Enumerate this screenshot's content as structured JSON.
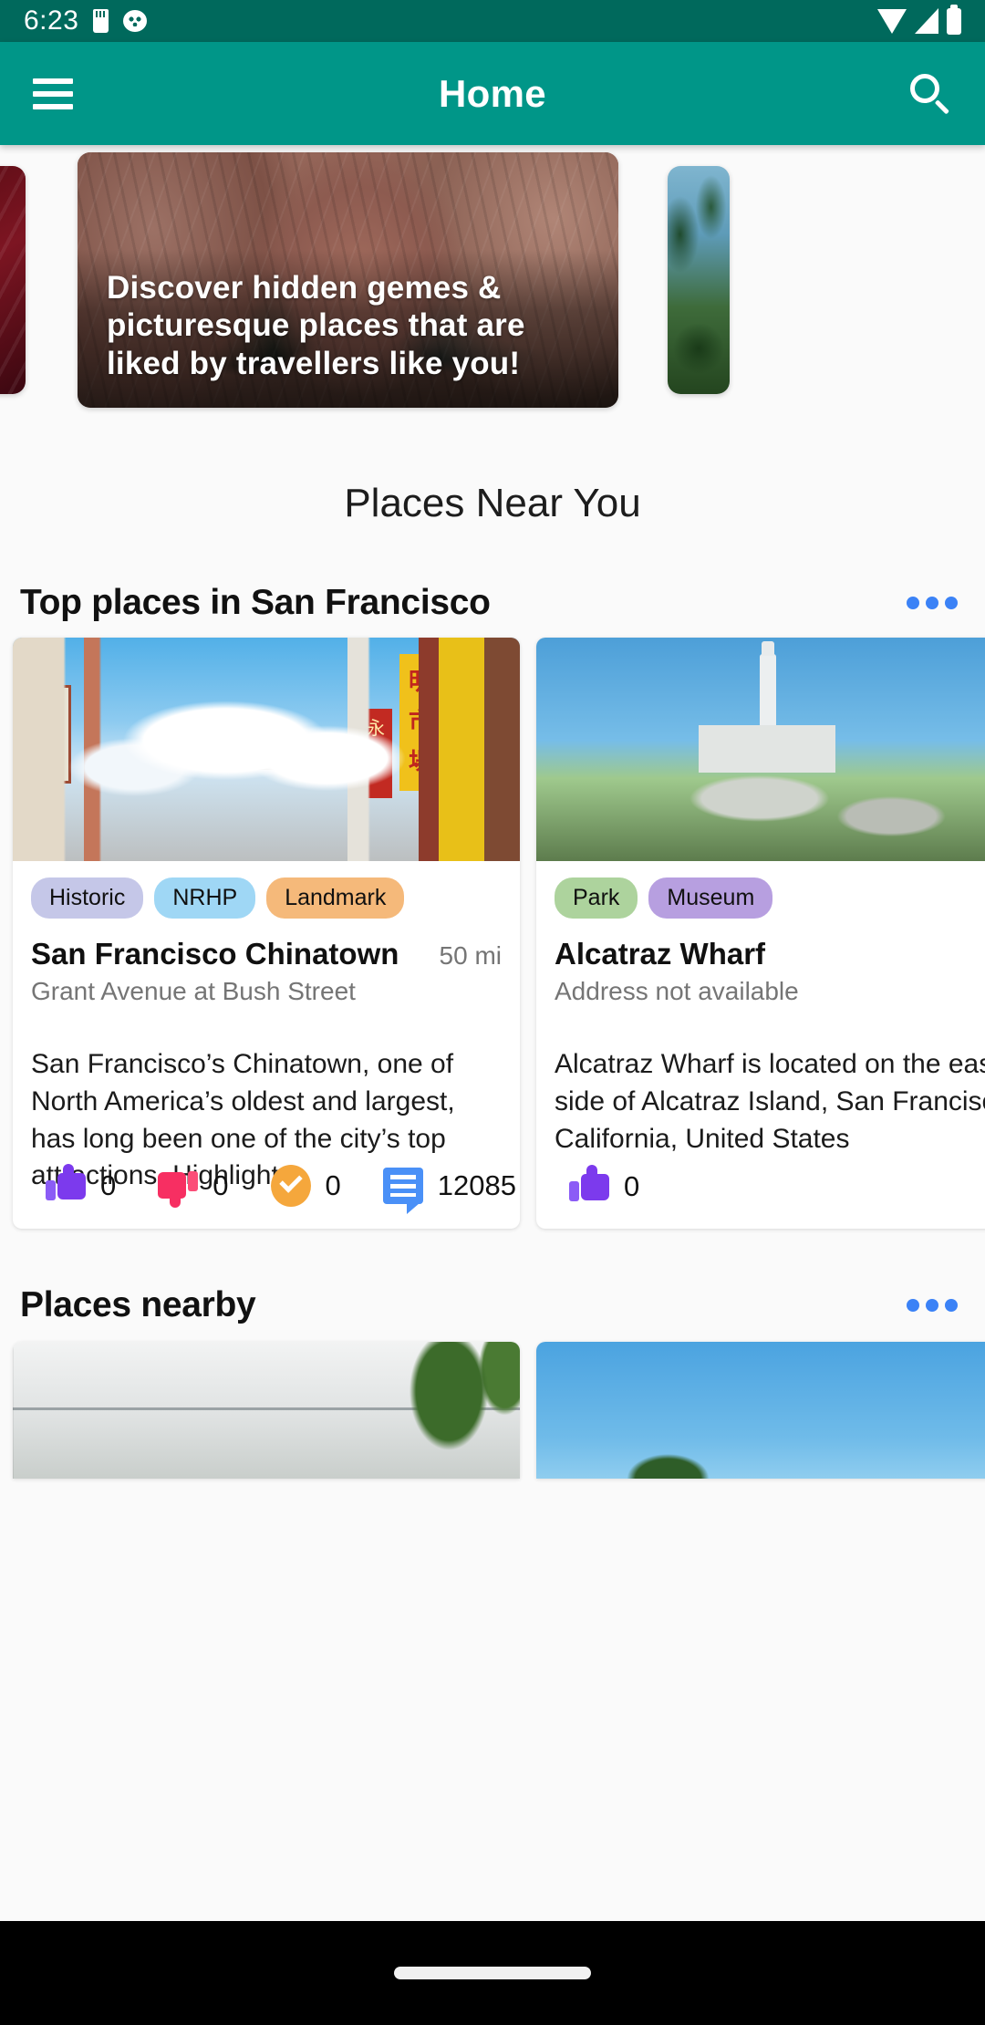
{
  "status_bar": {
    "clock": "6:23",
    "icons_left": [
      "sdcard-icon",
      "bug-icon"
    ],
    "icons_right": [
      "wifi-icon",
      "cellular-signal-icon",
      "battery-icon"
    ],
    "background_color": "#00695c"
  },
  "app_bar": {
    "title": "Home",
    "menu_icon": "hamburger-menu-icon",
    "search_icon": "search-icon",
    "background_color": "#009688"
  },
  "hero": {
    "caption": "Discover hidden gemes & picturesque places that are liked by travellers like you!"
  },
  "page_heading": "Places Near You",
  "sections": [
    {
      "title": "Top places in San Francisco",
      "overflow_icon": "more-options-icon",
      "cards": [
        {
          "tags": [
            {
              "label": "Historic",
              "color": "#c5c7e8"
            },
            {
              "label": "NRHP",
              "color": "#9fd7f5"
            },
            {
              "label": "Landmark",
              "color": "#f5b97a"
            }
          ],
          "title": "San Francisco Chinatown",
          "distance": "50 mi",
          "address": "Grant Avenue at Bush Street",
          "description": "San Francisco’s Chinatown, one of North America’s oldest and largest, has long been one of the city’s top attractions. Highlights",
          "actions": [
            {
              "icon": "thumbs-up-icon",
              "value": "0",
              "color": "#7c3aed"
            },
            {
              "icon": "thumbs-down-icon",
              "value": "0",
              "color": "#f72f62"
            },
            {
              "icon": "check-circle-icon",
              "value": "0",
              "color": "#f5a73c"
            },
            {
              "icon": "comment-icon",
              "value": "12085",
              "color": "#4a90f7"
            }
          ]
        },
        {
          "tags": [
            {
              "label": "Park",
              "color": "#add39d"
            },
            {
              "label": "Museum",
              "color": "#b79fe0"
            }
          ],
          "title": "Alcatraz Wharf",
          "distance": "",
          "address": "Address not available",
          "description": "Alcatraz Wharf is located on the east side of Alcatraz Island, San Francisco, California, United States",
          "actions": [
            {
              "icon": "thumbs-up-icon",
              "value": "0",
              "color": "#7c3aed"
            }
          ]
        }
      ]
    },
    {
      "title": "Places nearby",
      "overflow_icon": "more-options-icon",
      "cards": []
    }
  ],
  "bottom_nav": {
    "gesture_pill": "home-gesture-pill"
  }
}
